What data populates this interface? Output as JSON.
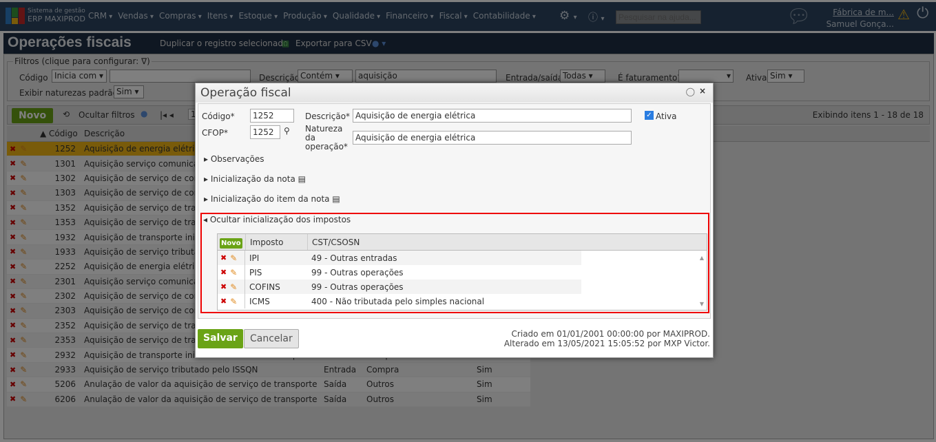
{
  "app": {
    "brand_top": "Sistema de gestão",
    "brand_bottom": "ERP MAXIPROD",
    "search_placeholder": "Pesquisar na ajuda...",
    "company": "Fábrica de m...",
    "user": "Samuel Gonça..."
  },
  "nav": [
    "CRM",
    "Vendas",
    "Compras",
    "Itens",
    "Estoque",
    "Produção",
    "Qualidade",
    "Financeiro",
    "Fiscal",
    "Contabilidade"
  ],
  "page": {
    "title": "Operações fiscais",
    "duplicate": "Duplicar o registro selecionado",
    "export": "Exportar para CSV"
  },
  "filters": {
    "legend": "Filtros (clique para configurar:",
    "codigo_label": "Código",
    "codigo_op": "Inicia com",
    "descricao_label": "Descrição",
    "descricao_op": "Contém",
    "descricao_value": "aquisição",
    "es_label": "Entrada/saída",
    "es_value": "Todas",
    "fat_label": "É faturamento?",
    "fat_value": "",
    "ativa_label": "Ativa",
    "ativa_value": "Sim",
    "nat_label": "Exibir naturezas padrão",
    "nat_value": "Sim"
  },
  "grid": {
    "new": "Novo",
    "hide_filters": "Ocultar filtros",
    "page": "1",
    "showing": "Exibindo itens 1 - 18 de 18",
    "col_code": "▲ Código",
    "col_desc": "Descrição",
    "rows": [
      {
        "code": "1252",
        "desc": "Aquisição de energia elétrica"
      },
      {
        "code": "1301",
        "desc": "Aquisição serviço comunicação"
      },
      {
        "code": "1302",
        "desc": "Aquisição de serviço de comunicação"
      },
      {
        "code": "1303",
        "desc": "Aquisição de serviço de comunicação"
      },
      {
        "code": "1352",
        "desc": "Aquisição de serviço de transporte"
      },
      {
        "code": "1353",
        "desc": "Aquisição de serviço de transporte"
      },
      {
        "code": "1932",
        "desc": "Aquisição de transporte iniciado"
      },
      {
        "code": "1933",
        "desc": "Aquisição de serviço tributado"
      },
      {
        "code": "2252",
        "desc": "Aquisição de energia elétrica"
      },
      {
        "code": "2301",
        "desc": "Aquisição serviço comunicação"
      },
      {
        "code": "2302",
        "desc": "Aquisição de serviço de comunicação"
      },
      {
        "code": "2303",
        "desc": "Aquisição de serviço de comunicação"
      },
      {
        "code": "2352",
        "desc": "Aquisição de serviço de transporte"
      },
      {
        "code": "2353",
        "desc": "Aquisição de serviço de transporte"
      },
      {
        "code": "2932",
        "desc": "Aquisição de transporte iniciado em ur diverso do prestador",
        "es": "Entrada",
        "tipo": "Compra",
        "ativa": "Sim"
      },
      {
        "code": "2933",
        "desc": "Aquisição de serviço tributado pelo ISSQN",
        "es": "Entrada",
        "tipo": "Compra",
        "ativa": "Sim"
      },
      {
        "code": "5206",
        "desc": "Anulação de valor da aquisição de serviço de transporte",
        "es": "Saída",
        "tipo": "Outros",
        "ativa": "Sim"
      },
      {
        "code": "6206",
        "desc": "Anulação de valor da aquisição de serviço de transporte",
        "es": "Saída",
        "tipo": "Outros",
        "ativa": "Sim"
      }
    ]
  },
  "modal": {
    "title": "Operação fiscal",
    "codigo_label": "Código*",
    "codigo": "1252",
    "cfop_label": "CFOP*",
    "cfop": "1252",
    "desc_label": "Descrição*",
    "desc": "Aquisição de energia elétrica",
    "nat_label1": "Natureza",
    "nat_label2": "da",
    "nat_label3": "operação*",
    "nat": "Aquisição de energia elétrica",
    "ativa": "Ativa",
    "sec_obs": "Observações",
    "sec_nota": "Inicialização da nota",
    "sec_item": "Inicialização do item da nota",
    "sec_imp": "Ocultar inicialização dos impostos",
    "tax_new": "Novo",
    "tax_col1": "Imposto",
    "tax_col2": "CST/CSOSN",
    "taxes": [
      {
        "imp": "IPI",
        "cst": "49 - Outras entradas"
      },
      {
        "imp": "PIS",
        "cst": "99 - Outras operações"
      },
      {
        "imp": "COFINS",
        "cst": "99 - Outras operações"
      },
      {
        "imp": "ICMS",
        "cst": "400 - Não tributada pelo simples nacional"
      }
    ],
    "save": "Salvar",
    "cancel": "Cancelar",
    "created": "Criado em 01/01/2001 00:00:00 por MAXIPROD.",
    "changed": "Alterado em 13/05/2021 15:05:52 por MXP Victor."
  }
}
